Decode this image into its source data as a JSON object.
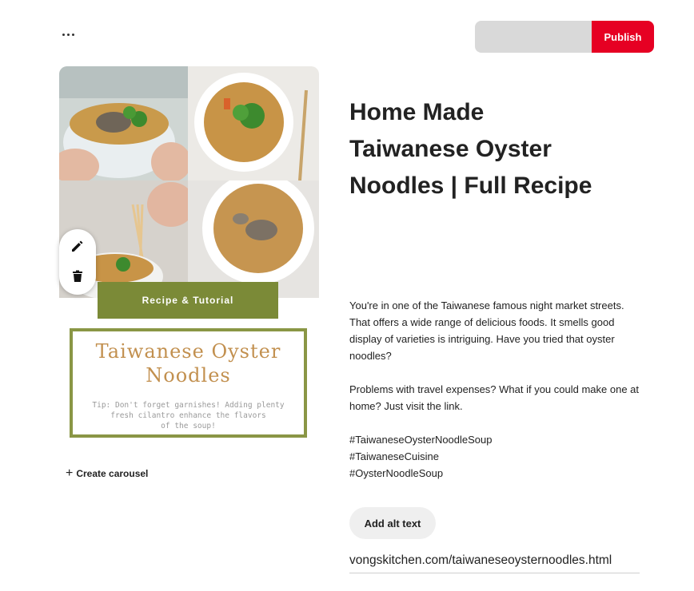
{
  "toolbar": {
    "more_icon": "more-horizontal-icon",
    "publish_label": "Publish",
    "publish_color": "#e60023",
    "board_select_value": ""
  },
  "pin": {
    "image": {
      "band_text": "Recipe & Tutorial",
      "title_line1": "Taiwanese Oyster",
      "title_line2": "Noodles",
      "tip_line1": "Tip: Don't forget garnishes! Adding plenty",
      "tip_line2": "fresh cilantro enhance the flavors",
      "tip_line3": "of the soup!",
      "band_color": "#7b8a37"
    },
    "tools": {
      "edit_icon": "pencil-icon",
      "delete_icon": "trash-icon"
    },
    "create_carousel_label": "Create carousel",
    "title_line1": "Home Made",
    "title_line2": "Taiwanese Oyster",
    "title_line3": "Noodles | Full Recipe",
    "description": {
      "p1": "You're in one of the Taiwanese famous night market streets. That offers a wide range of delicious foods. It smells good display of varieties is intriguing. Have you tried that oyster noodles?",
      "p2": "Problems with travel expenses? What if you could make one at home? Just visit the link.",
      "tags": [
        "#TaiwaneseOysterNoodleSoup",
        "#TaiwaneseCuisine",
        "#OysterNoodleSoup"
      ]
    },
    "alt_text_label": "Add alt text",
    "link_value": "vongskitchen.com/taiwaneseoysternoodles.html"
  }
}
